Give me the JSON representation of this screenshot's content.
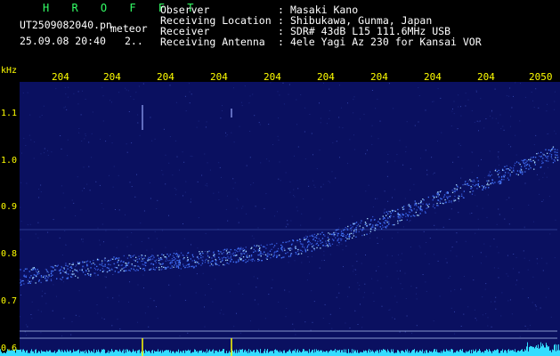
{
  "app": {
    "title": "H R O F F T",
    "subtitle": "meteor"
  },
  "file": {
    "name": "UT2509082040.pn",
    "datetime": "25.09.08 20:40",
    "extra": "2.."
  },
  "info": {
    "rows": [
      {
        "label": "Observer",
        "sep": ":",
        "value": "Masaki Kano"
      },
      {
        "label": "Receiving Location",
        "sep": ":",
        "value": "Shibukawa, Gunma, Japan"
      },
      {
        "label": "Receiver",
        "sep": ":",
        "value": "SDR# 43dB L15 111.6MHz USB"
      },
      {
        "label": "Receiving Antenna",
        "sep": ":",
        "value": "4ele Yagi Az 230 for Kansai VOR"
      }
    ]
  },
  "colors": {
    "accent_green": "#33ff66",
    "tick_yellow": "#ffff00",
    "signal_cyan": "#33ddff",
    "background_blue": "#0a1060"
  },
  "chart_data": {
    "type": "heatmap",
    "yunit": "kHz",
    "x_ticks": [
      "204",
      "204",
      "204",
      "204",
      "204",
      "204",
      "204",
      "204",
      "204",
      "2050"
    ],
    "y_ticks": [
      "1.1",
      "1.0",
      "0.9",
      "0.8",
      "0.7",
      "0.6"
    ],
    "ylim": [
      0.59,
      1.17
    ],
    "trace": {
      "x": [
        0,
        0.1,
        0.2,
        0.3,
        0.4,
        0.5,
        0.6,
        0.7,
        0.8,
        0.9,
        1.0
      ],
      "y": [
        0.755,
        0.77,
        0.785,
        0.79,
        0.8,
        0.815,
        0.845,
        0.885,
        0.93,
        0.975,
        1.02
      ]
    }
  }
}
